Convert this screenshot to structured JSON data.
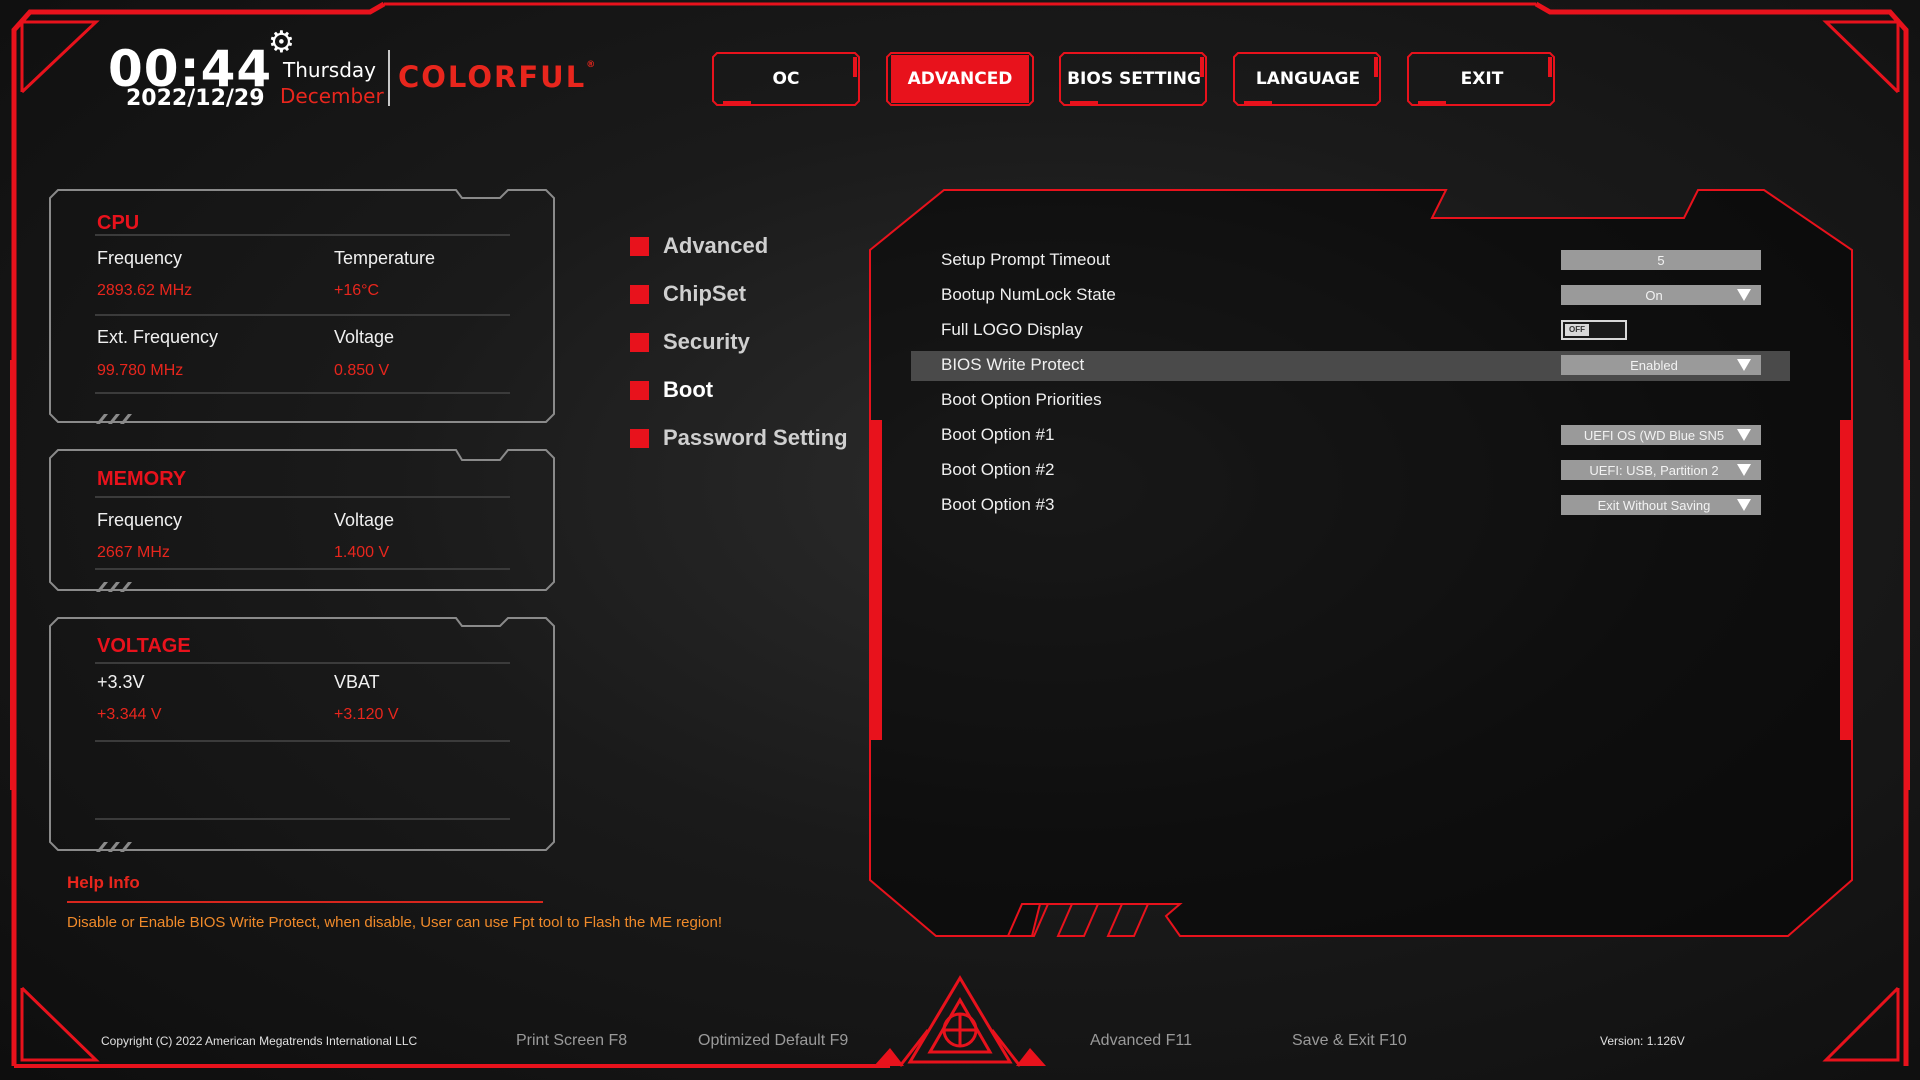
{
  "header": {
    "time": "00:44",
    "date": "2022/12/29",
    "weekday": "Thursday",
    "month": "December",
    "brand": "COLORFUL",
    "brand_mark": "®"
  },
  "tabs": [
    {
      "label": "OC",
      "active": false
    },
    {
      "label": "ADVANCED",
      "active": true
    },
    {
      "label": "BIOS SETTING",
      "active": false
    },
    {
      "label": "LANGUAGE",
      "active": false
    },
    {
      "label": "EXIT",
      "active": false
    }
  ],
  "cpu": {
    "title": "CPU",
    "frequency_label": "Frequency",
    "frequency": "2893.62 MHz",
    "temperature_label": "Temperature",
    "temperature": "+16°C",
    "ext_frequency_label": "Ext. Frequency",
    "ext_frequency": "99.780 MHz",
    "voltage_label": "Voltage",
    "voltage": "0.850 V"
  },
  "memory": {
    "title": "MEMORY",
    "frequency_label": "Frequency",
    "frequency": "2667 MHz",
    "voltage_label": "Voltage",
    "voltage": "1.400 V"
  },
  "voltage": {
    "title": "VOLTAGE",
    "v33_label": "+3.3V",
    "v33": "+3.344 V",
    "vbat_label": "VBAT",
    "vbat": "+3.120 V"
  },
  "menu": [
    {
      "label": "Advanced",
      "active": false
    },
    {
      "label": "ChipSet",
      "active": false
    },
    {
      "label": "Security",
      "active": false
    },
    {
      "label": "Boot",
      "active": true
    },
    {
      "label": "Password Setting",
      "active": false
    }
  ],
  "settings": [
    {
      "label": "Setup Prompt Timeout",
      "type": "input",
      "value": "5"
    },
    {
      "label": "Bootup NumLock State",
      "type": "select",
      "value": "On"
    },
    {
      "label": "Full LOGO Display",
      "type": "toggle",
      "value": "OFF"
    },
    {
      "label": "BIOS Write Protect",
      "type": "select",
      "value": "Enabled",
      "highlighted": true
    },
    {
      "label": "Boot Option Priorities",
      "type": "none",
      "value": ""
    },
    {
      "label": "Boot Option #1",
      "type": "select",
      "value": "UEFI OS (WD Blue SN5"
    },
    {
      "label": "Boot Option #2",
      "type": "select",
      "value": "UEFI:  USB, Partition 2"
    },
    {
      "label": "Boot Option #3",
      "type": "select",
      "value": "Exit Without Saving"
    }
  ],
  "help": {
    "title": "Help Info",
    "text": "Disable or Enable BIOS Write Protect, when disable, User can use Fpt tool to Flash the ME region!"
  },
  "footer": {
    "copyright": "Copyright (C) 2022 American Megatrends International LLC",
    "print_screen": "Print Screen F8",
    "optimized_default": "Optimized Default F9",
    "advanced": "Advanced F11",
    "save_exit": "Save & Exit F10",
    "version": "Version: 1.126V"
  },
  "colors": {
    "accent": "#e8121c",
    "value_text": "#e8261d",
    "help_text": "#f08a2a",
    "control_bg": "#9a9a9a",
    "highlight_row": "#4a4a4a"
  }
}
